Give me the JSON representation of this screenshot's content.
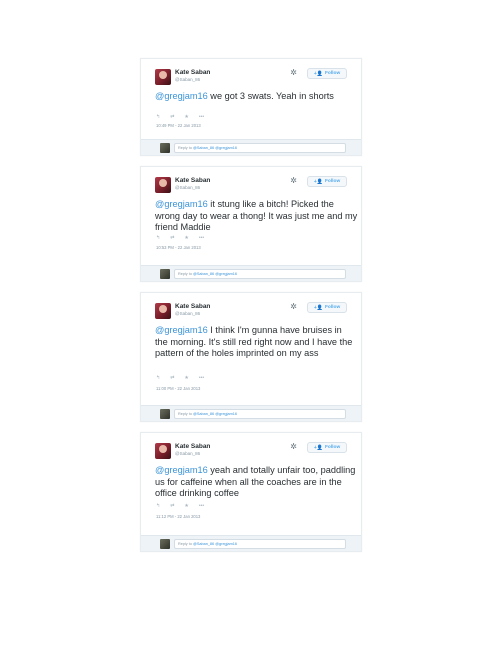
{
  "tweets": [
    {
      "user_name": "Kate Saban",
      "user_handle": "@Saban_86",
      "follow_label": "Follow",
      "mention": "@gregjam16",
      "text": " we got 3 swats. Yeah in shorts",
      "timestamp": "10:49 PM - 22 Jan 2013",
      "reply_prefix": "Reply to ",
      "reply_mentions": "@Saban_86 @gregjam16"
    },
    {
      "user_name": "Kate Saban",
      "user_handle": "@Saban_86",
      "follow_label": "Follow",
      "mention": "@gregjam16",
      "text": " it stung like a bitch! Picked the wrong day to wear a thong! It was just me and my friend Maddie",
      "timestamp": "10:53 PM - 22 Jan 2013",
      "reply_prefix": "Reply to ",
      "reply_mentions": "@Saban_86 @gregjam16"
    },
    {
      "user_name": "Kate Saban",
      "user_handle": "@Saban_86",
      "follow_label": "Follow",
      "mention": "@gregjam16",
      "text": " I think I'm gunna have bruises in the morning. It's still red right now and I have the pattern of the holes imprinted on my ass",
      "timestamp": "11:00 PM - 22 Jan 2013",
      "reply_prefix": "Reply to ",
      "reply_mentions": "@Saban_86 @gregjam16"
    },
    {
      "user_name": "Kate Saban",
      "user_handle": "@Saban_86",
      "follow_label": "Follow",
      "mention": "@gregjam16",
      "text": " yeah and totally unfair too, paddling us for caffeine when all the coaches are in the office drinking coffee",
      "timestamp": "11:12 PM - 22 Jan 2013",
      "reply_prefix": "Reply to ",
      "reply_mentions": "@Saban_86 @gregjam16"
    }
  ],
  "icons": {
    "gear": "gear-icon",
    "follow": "follow-person-icon",
    "reply": "reply-icon",
    "retweet": "retweet-icon",
    "favorite": "favorite-icon",
    "more": "more-icon"
  },
  "colors": {
    "link": "#3b94d9",
    "follow_text": "#55acee",
    "reply_bar": "#eef3f7"
  }
}
